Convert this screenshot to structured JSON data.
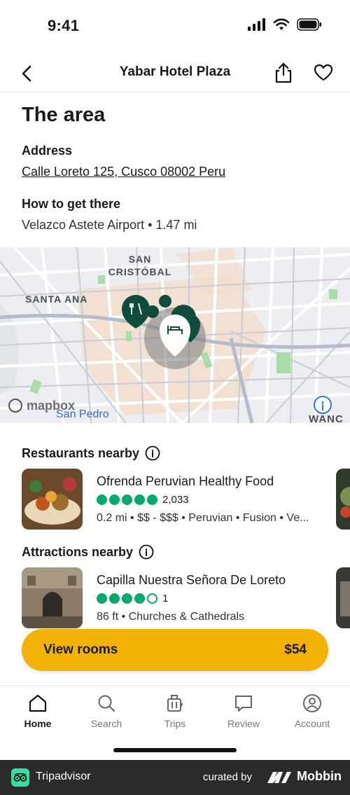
{
  "status": {
    "time": "9:41"
  },
  "header": {
    "title": "Yabar Hotel Plaza"
  },
  "area": {
    "title": "The area",
    "address_label": "Address",
    "address_value": "Calle Loreto 125, Cusco 08002 Peru",
    "directions_label": "How to get there",
    "directions_value": "Velazco Astete Airport • 1.47 mi"
  },
  "map": {
    "labels": {
      "san_cristobal_1": "SAN",
      "san_cristobal_2": "CRISTÓBAL",
      "santa_ana": "SANTA ANA",
      "san_pedro": "San Pedro",
      "wanchaq": "WANC",
      "attribution": "mapbox"
    }
  },
  "restaurants": {
    "heading": "Restaurants nearby",
    "item": {
      "name": "Ofrenda Peruvian Healthy Food",
      "rating": 5,
      "reviews": "2,033",
      "meta": "0.2 mi • $$ - $$$ • Peruvian • Fusion • Ve..."
    }
  },
  "attractions": {
    "heading": "Attractions nearby",
    "item": {
      "name": "Capilla Nuestra Señora De Loreto",
      "rating": 4,
      "reviews": "1",
      "meta": "86 ft • Churches & Cathedrals"
    }
  },
  "cta": {
    "label": "View rooms",
    "price": "$54"
  },
  "tabs": [
    {
      "label": "Home",
      "icon": "home-icon",
      "active": true
    },
    {
      "label": "Search",
      "icon": "search-icon",
      "active": false
    },
    {
      "label": "Trips",
      "icon": "trips-icon",
      "active": false
    },
    {
      "label": "Review",
      "icon": "review-icon",
      "active": false
    },
    {
      "label": "Account",
      "icon": "account-icon",
      "active": false
    }
  ],
  "footer": {
    "brand": "Tripadvisor",
    "curated": "curated by",
    "mobbin": "Mobbin"
  },
  "colors": {
    "accent": "#f2b203",
    "rating": "#00aa6c",
    "pin": "#0e4d3c"
  }
}
